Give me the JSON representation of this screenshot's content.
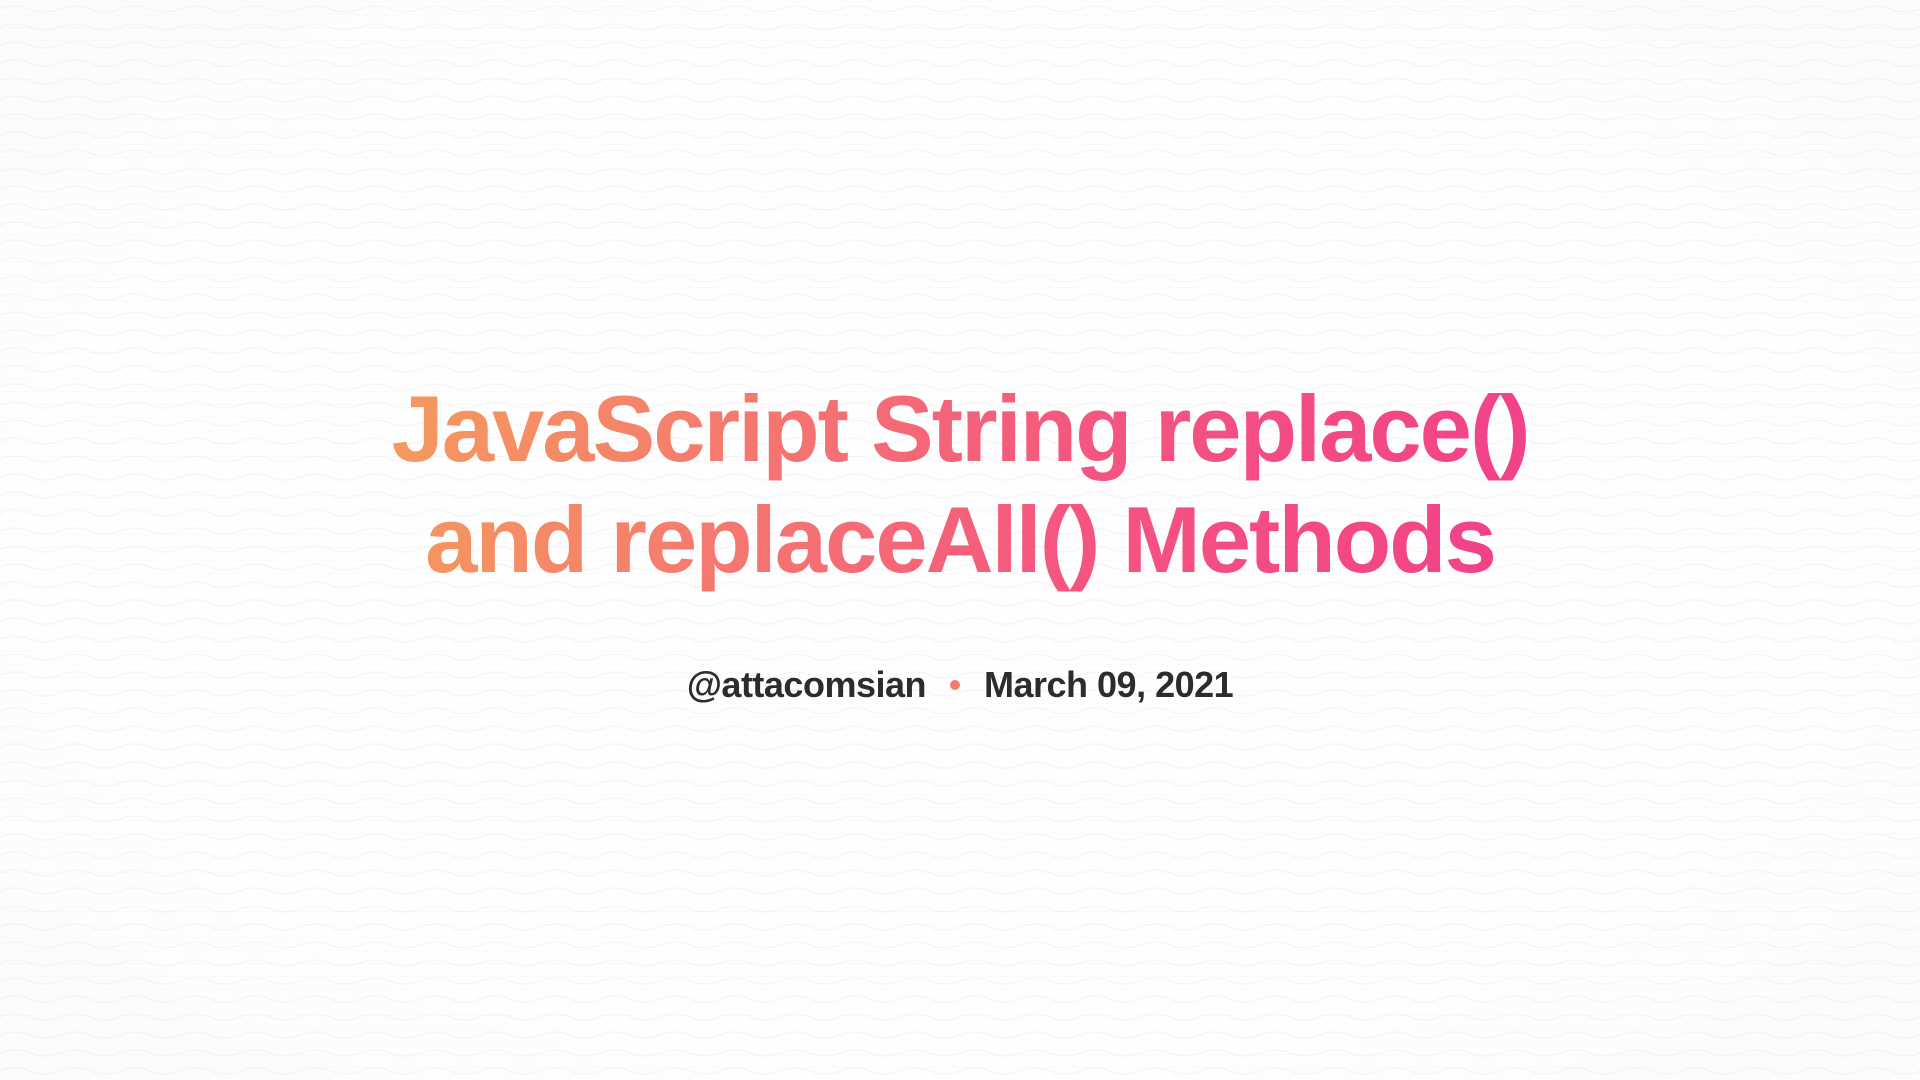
{
  "title": "JavaScript String replace() and replaceAll() Methods",
  "author": "@attacomsian",
  "date": "March 09, 2021"
}
